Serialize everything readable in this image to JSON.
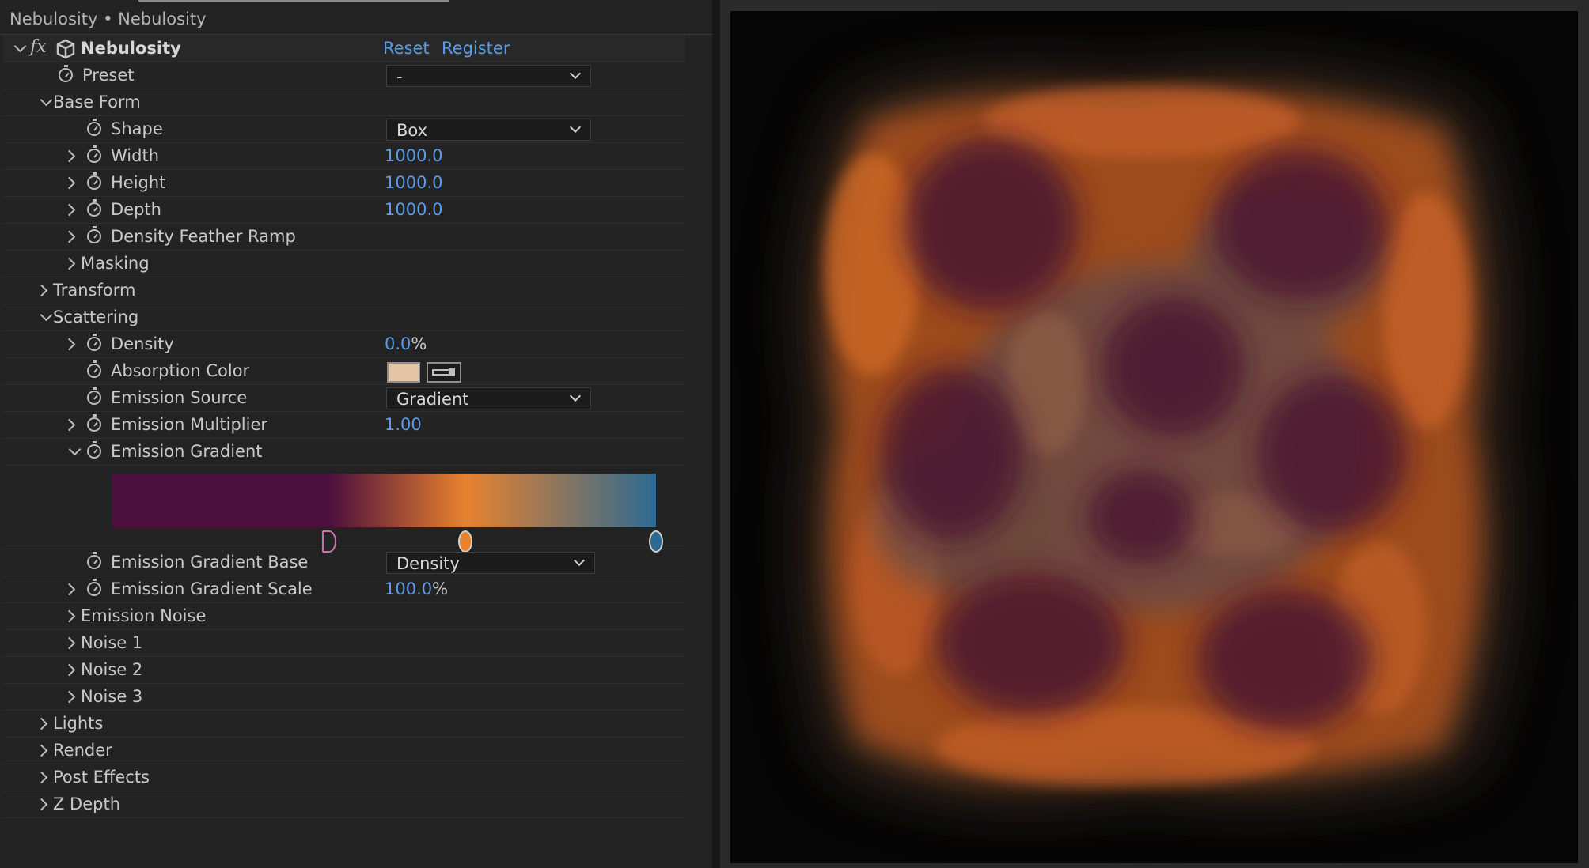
{
  "panel": {
    "title": "Nebulosity • Nebulosity",
    "effect_name": "Nebulosity",
    "reset_label": "Reset",
    "register_label": "Register"
  },
  "rows": {
    "preset": {
      "label": "Preset",
      "value": "-"
    },
    "base_form": {
      "label": "Base Form"
    },
    "shape": {
      "label": "Shape",
      "value": "Box"
    },
    "width": {
      "label": "Width",
      "value": "1000.0"
    },
    "height": {
      "label": "Height",
      "value": "1000.0"
    },
    "depth": {
      "label": "Depth",
      "value": "1000.0"
    },
    "density_feather_ramp": {
      "label": "Density Feather Ramp"
    },
    "masking": {
      "label": "Masking"
    },
    "transform": {
      "label": "Transform"
    },
    "scattering": {
      "label": "Scattering"
    },
    "density": {
      "label": "Density",
      "value": "0.0",
      "unit": "%"
    },
    "absorption_color": {
      "label": "Absorption Color",
      "color": "#e3c4a6"
    },
    "emission_source": {
      "label": "Emission Source",
      "value": "Gradient"
    },
    "emission_multiplier": {
      "label": "Emission Multiplier",
      "value": "1.00"
    },
    "emission_gradient": {
      "label": "Emission Gradient",
      "stops": [
        {
          "color": "#4d0f3d",
          "position": 0.4
        },
        {
          "color": "#e8822e",
          "position": 0.65
        },
        {
          "color": "#2d6a92",
          "position": 1.0
        }
      ]
    },
    "emission_gradient_base": {
      "label": "Emission Gradient Base",
      "value": "Density"
    },
    "emission_gradient_scale": {
      "label": "Emission Gradient Scale",
      "value": "100.0",
      "unit": "%"
    },
    "emission_noise": {
      "label": "Emission Noise"
    },
    "noise1": {
      "label": "Noise 1"
    },
    "noise2": {
      "label": "Noise 2"
    },
    "noise3": {
      "label": "Noise 3"
    },
    "lights": {
      "label": "Lights"
    },
    "render": {
      "label": "Render"
    },
    "post_effects": {
      "label": "Post Effects"
    },
    "z_depth": {
      "label": "Z Depth"
    }
  },
  "colors": {
    "accent_blue": "#5b9ce8",
    "panel_bg": "#232323"
  }
}
